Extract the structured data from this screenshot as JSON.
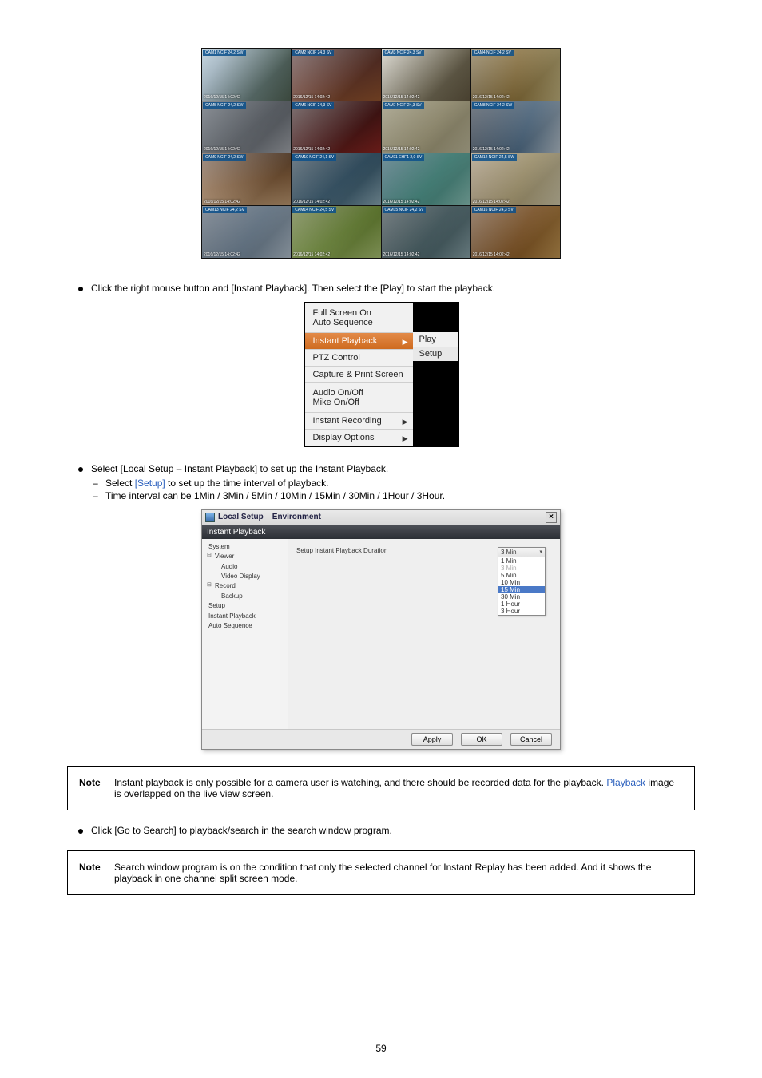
{
  "cameraGrid": {
    "label_prefix": "CAM",
    "timestamp": "2016/12/15  14:02:42"
  },
  "bullet_context_menu": "Click the right mouse button and [Instant Playback]. Then select the [Play] to start the playback.",
  "contextMenu": {
    "items": [
      "Full Screen On",
      "Auto Sequence",
      "Instant Playback",
      "PTZ Control",
      "Capture & Print Screen",
      "Audio On/Off",
      "Mike On/Off",
      "Instant Recording",
      "Display Options"
    ],
    "sub": [
      "Play",
      "Setup"
    ]
  },
  "bullet_setup_intro": "Select [Local Setup – Instant Playback] to set up the Instant Playback.",
  "dash_setup_1_pre": "Select ",
  "dash_setup_1_link": "[Setup]",
  "dash_setup_1_post": " to set up the time interval of playback.",
  "dash_setup_2": "Time interval can be 1Min / 3Min / 5Min / 10Min / 15Min / 30Min / 1Hour / 3Hour.",
  "dialog": {
    "title": "Local Setup – Environment",
    "subtitle": "Instant Playback",
    "tree": {
      "system": "System",
      "viewer": "Viewer",
      "audio": "Audio",
      "video_display": "Video Display",
      "record": "Record",
      "backup": "Backup",
      "setup": "Setup",
      "instant_playback": "Instant Playback",
      "auto_sequence": "Auto Sequence"
    },
    "field_label": "Setup Instant Playback Duration",
    "dd_top": "3 Min",
    "dd_opts": [
      "1 Min",
      "3 Min",
      "5 Min",
      "10 Min",
      "15 Min",
      "30 Min",
      "1 Hour",
      "3 Hour"
    ],
    "buttons": {
      "apply": "Apply",
      "ok": "OK",
      "cancel": "Cancel"
    },
    "close": "×"
  },
  "noteA": {
    "tag": "Note",
    "line1_pre": "Instant playback is only possible for a camera user is watching, and there should be recorded data for the playback. ",
    "line1_link": "Playback",
    "line1_post": " image is overlapped on the live view screen."
  },
  "bullet_go_search": "Click [Go to Search] to playback/search in the search window program.",
  "noteB": {
    "tag": "Note",
    "text": "Search window program is on the condition that only the selected channel for Instant Replay has been added. And it shows the playback in one channel split screen mode."
  },
  "page_number": "59"
}
